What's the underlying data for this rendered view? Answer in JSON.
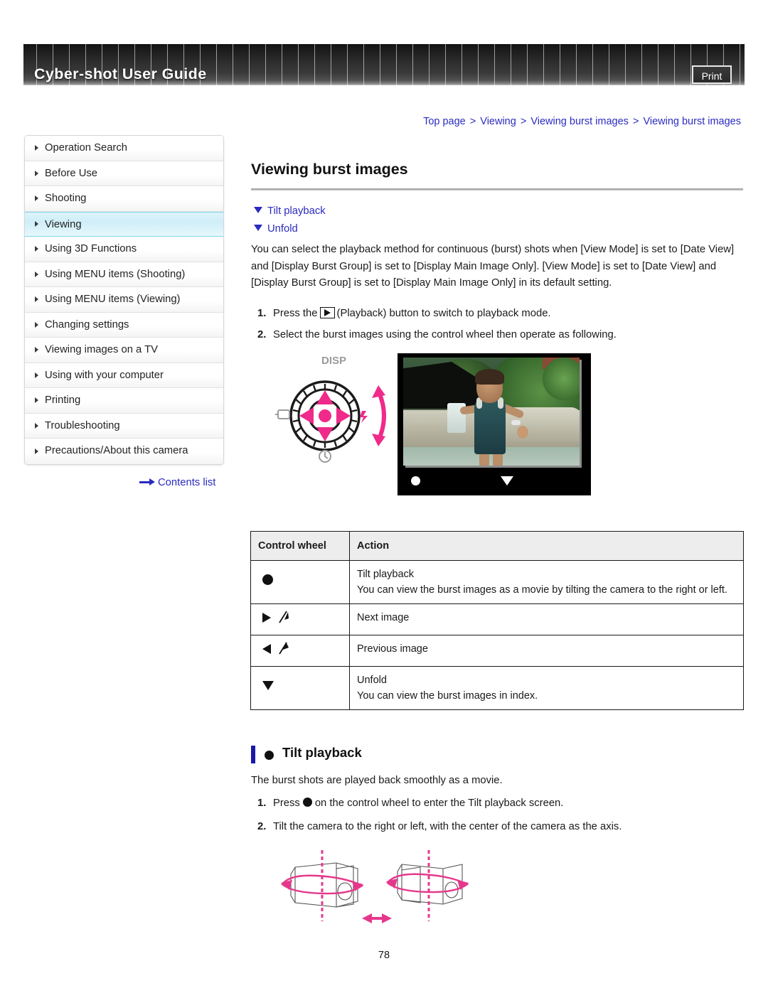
{
  "header": {
    "title": "Cyber-shot User Guide",
    "print_label": "Print"
  },
  "breadcrumb": {
    "items": [
      "Top page",
      "Viewing",
      "Viewing burst images",
      "Viewing burst images"
    ],
    "separator": ">",
    "full_text": "Top page > Viewing > Viewing burst images > Viewing burst images"
  },
  "sidebar": {
    "items": [
      {
        "label": "Operation Search",
        "active": false
      },
      {
        "label": "Before Use",
        "active": false
      },
      {
        "label": "Shooting",
        "active": false
      },
      {
        "label": "Viewing",
        "active": true
      },
      {
        "label": "Using 3D Functions",
        "active": false
      },
      {
        "label": "Using MENU items (Shooting)",
        "active": false
      },
      {
        "label": "Using MENU items (Viewing)",
        "active": false
      },
      {
        "label": "Changing settings",
        "active": false
      },
      {
        "label": "Viewing images on a TV",
        "active": false
      },
      {
        "label": "Using with your computer",
        "active": false
      },
      {
        "label": "Printing",
        "active": false
      },
      {
        "label": "Troubleshooting",
        "active": false
      },
      {
        "label": "Precautions/About this camera",
        "active": false
      }
    ],
    "contents_link": "Contents list"
  },
  "main": {
    "page_title": "Viewing burst images",
    "jump_links": [
      {
        "label": "Tilt playback"
      },
      {
        "label": "Unfold"
      }
    ],
    "intro_paragraph": "You can select the playback method for continuous (burst) shots when [View Mode] is set to [Date View] and [Display Burst Group] is set to [Display Main Image Only]. [View Mode] is set to [Date View] and [Display Burst Group] is set to [Display Main Image Only] in its default setting.",
    "steps": [
      {
        "num": "1.",
        "text_before_icon": "Press the",
        "icon": "playback-icon",
        "text_after_icon": "(Playback) button to switch to playback mode."
      },
      {
        "num": "2.",
        "text": "Select the burst images using the control wheel then operate as following."
      }
    ],
    "wheel_figure": {
      "disp_label": "DISP",
      "accent_color": "#ef2a8a"
    },
    "camera_screen": {
      "bottom_dot": "center-button-indicator",
      "bottom_triangle": "down-button-indicator"
    }
  },
  "table": {
    "headers": [
      "Control wheel",
      "Action"
    ],
    "rows": [
      {
        "icon": "center-dot-icon",
        "action_title": "Tilt playback",
        "action_body": "You can view the burst images as a movie by tilting the camera to the right or left."
      },
      {
        "icon": "right-triangle-rotate-icon",
        "action_title": "Next image",
        "action_body": ""
      },
      {
        "icon": "left-triangle-rotate-icon",
        "action_title": "Previous image",
        "action_body": ""
      },
      {
        "icon": "down-triangle-icon",
        "action_title": "Unfold",
        "action_body": "You can view the burst images in index."
      }
    ]
  },
  "tilt_section": {
    "heading": "Tilt playback",
    "paragraph": "The burst shots are played back smoothly as a movie.",
    "steps": [
      {
        "num": "1.",
        "text_before_icon": "Press",
        "icon": "center-dot-icon",
        "text_after_icon": "on the control wheel to enter the Tilt playback screen."
      },
      {
        "num": "2.",
        "text": "Tilt the camera to the right or left, with the center of the camera as the axis."
      }
    ],
    "diagram_accent_color": "#e5388c"
  },
  "footer": {
    "page_number": "78"
  },
  "colors": {
    "link_blue": "#2b2bc0",
    "accent_pink": "#ef2a8a",
    "heading_bar_blue": "#1a1aa8",
    "active_nav": "#cfeef8",
    "table_header_bg": "#ededed"
  }
}
